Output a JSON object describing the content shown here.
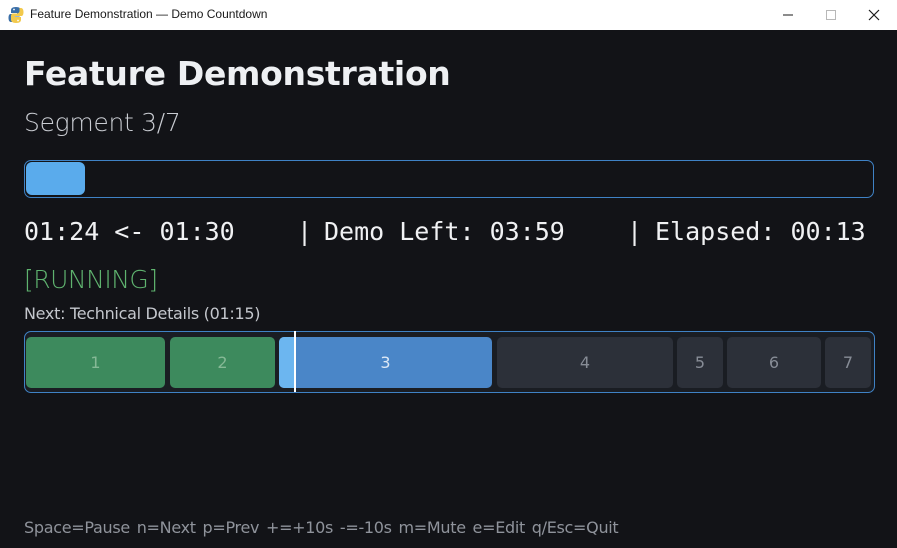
{
  "window": {
    "title": "Feature Demonstration — Demo Countdown",
    "app_icon": "python-icon",
    "controls": [
      "minimize-icon",
      "maximize-icon",
      "close-icon"
    ]
  },
  "header": {
    "title": "Feature Demonstration",
    "segment": "Segment 3/7"
  },
  "progress": {
    "fraction": 0.07
  },
  "timers": {
    "countdown": "01:24 <- 01:30",
    "separator": "|",
    "demo_left": "Demo Left: 03:59",
    "elapsed": "Elapsed: 00:13"
  },
  "status": {
    "text": "[RUNNING]",
    "color": "#5fb36f"
  },
  "next": {
    "text": "Next: Technical Details (01:15)"
  },
  "timeline": {
    "current_index": 3,
    "segments": [
      {
        "label": "1",
        "state": "done"
      },
      {
        "label": "2",
        "state": "done"
      },
      {
        "label": "3",
        "state": "current"
      },
      {
        "label": "4",
        "state": "pending"
      },
      {
        "label": "5",
        "state": "pending"
      },
      {
        "label": "6",
        "state": "pending"
      },
      {
        "label": "7",
        "state": "pending"
      }
    ]
  },
  "footer": {
    "hotkeys": "Space=Pause  n=Next  p=Prev  +=+10s  -=-10s  m=Mute  e=Edit  q/Esc=Quit"
  },
  "colors": {
    "background": "#121317",
    "accent": "#3f82c5",
    "progress_fill": "#5aabec",
    "done": "#3d8a5d",
    "current": "#4a86c8",
    "pending": "#2c3039"
  }
}
